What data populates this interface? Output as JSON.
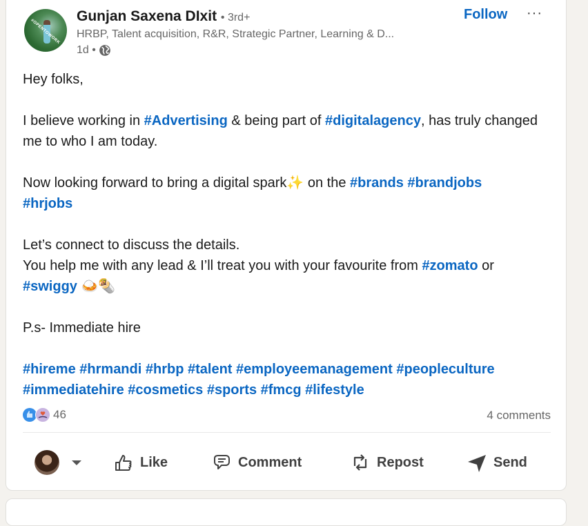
{
  "post": {
    "author": {
      "name": "Gunjan Saxena DIxit",
      "degree": "• 3rd+",
      "headline": "HRBP, Talent acquisition, R&R, Strategic Partner, Learning & D...",
      "time": "1d •",
      "avatar_badge": "#OPENTOWORK",
      "visibility_icon": "globe-icon"
    },
    "follow_label": "Follow",
    "more_label": "···",
    "body": {
      "greeting": "Hey folks,",
      "p1_a": "I believe working in ",
      "p1_tag1": "#Advertising",
      "p1_b": " & being part of ",
      "p1_tag2": "#digitalagency",
      "p1_c": ", has truly changed me to who I am today.",
      "p2_a": "Now looking forward to bring a digital spark",
      "p2_emoji": "✨",
      "p2_b": " on the ",
      "p2_tag1": "#brands",
      "p2_tag2": "#brandjobs",
      "p2_tag3": "#hrjobs",
      "p3_line1": "Let’s connect to discuss the details.",
      "p3_a": "You help me with any lead & I’ll treat you with your favourite from ",
      "p3_tag1": "#zomato",
      "p3_b": " or ",
      "p3_tag2": "#swiggy",
      "p3_emoji": " 🍛🌯",
      "p4": "P.s- Immediate hire",
      "hashtags": [
        "#hireme",
        "#hrmandi",
        "#hrbp",
        "#talent",
        "#employeemanagement",
        "#peopleculture",
        "#immediatehire",
        "#cosmetics",
        "#sports",
        "#fmcg",
        "#lifestyle"
      ]
    },
    "reactions": {
      "count": "46",
      "types": [
        "like",
        "love"
      ]
    },
    "comments_label": "4 comments",
    "actions": {
      "like": "Like",
      "comment": "Comment",
      "repost": "Repost",
      "send": "Send"
    },
    "colors": {
      "link": "#0a66c2",
      "text": "#191919",
      "muted": "#666666",
      "background": "#f4f2ee"
    }
  }
}
